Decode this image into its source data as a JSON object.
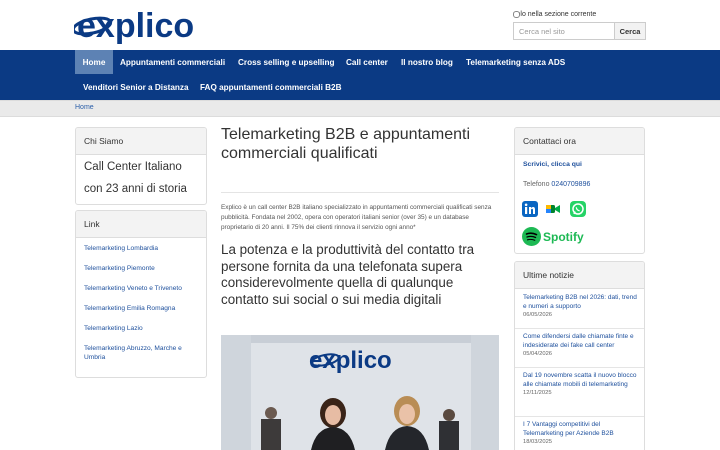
{
  "brand": {
    "logo_text": "explico"
  },
  "search": {
    "checkbox_label": "solo nella sezione corrente",
    "placeholder": "Cerca nel sito",
    "button_label": "Cerca"
  },
  "nav": {
    "items": [
      "Home",
      "Appuntamenti commerciali",
      "Cross selling e upselling",
      "Call center",
      "Il nostro blog",
      "Telemarketing senza ADS",
      "Venditori Senior a Distanza",
      "FAQ appuntamenti commerciali B2B"
    ],
    "active_index": 0
  },
  "breadcrumb": {
    "home": "Home"
  },
  "left": {
    "chi_siamo": {
      "heading": "Chi Siamo",
      "line1": "Call Center Italiano",
      "line2": "con 23 anni di storia"
    },
    "links": {
      "heading": "Link",
      "items": [
        "Telemarketing Lombardia",
        "Telemarketing Piemonte",
        "Telemarketing Veneto e Triveneto",
        "Telemarketing Emilia Romagna",
        "Telemarketing Lazio",
        "Telemarketing Abruzzo, Marche e Umbria"
      ]
    }
  },
  "main": {
    "title": "Telemarketing B2B e appuntamenti commerciali qualificati",
    "intro": "Explico è un call center B2B italiano specializzato in appuntamenti commerciali qualificati senza pubblicità. Fondata nel 2002, opera con operatori italiani senior (over 35) e un database proprietario di 20 anni. Il 75% dei clienti rinnova il servizio ogni anno*",
    "subtitle": "La potenza e la produttività del contatto tra persone fornita da una telefonata supera considerevolmente quella di qualunque contatto sui social o sui media digitali",
    "photo_logo": "explico"
  },
  "right": {
    "contact": {
      "heading": "Contattaci ora",
      "write_link": "Scrivici, clicca qui",
      "phone_label": "Telefono",
      "phone_number": "0240709896",
      "social": [
        "linkedin-icon",
        "google-meet-icon",
        "whatsapp-icon",
        "spotify-icon"
      ],
      "spotify_label": "Spotify"
    },
    "news": {
      "heading": "Ultime notizie",
      "items": [
        {
          "title": "Telemarketing B2B nel 2026: dati, trend e numeri a supporto",
          "date": "06/05/2026"
        },
        {
          "title": "Come difendersi dalle chiamate finte e indesiderate dei fake call center",
          "date": "05/04/2026"
        },
        {
          "title": "Dal 19 novembre scatta il nuovo blocco alle chiamate mobili di telemarketing",
          "date": "12/11/2025"
        },
        {
          "title": "I 7 Vantaggi competitivi del Telemarketing per Aziende B2B",
          "date": "18/03/2025"
        }
      ]
    }
  },
  "colors": {
    "nav_bg": "#0b3a84",
    "nav_active": "#5d82b4",
    "link": "#1d4f9c",
    "spotify": "#1db954",
    "whatsapp": "#25d366",
    "linkedin": "#0a66c2"
  }
}
